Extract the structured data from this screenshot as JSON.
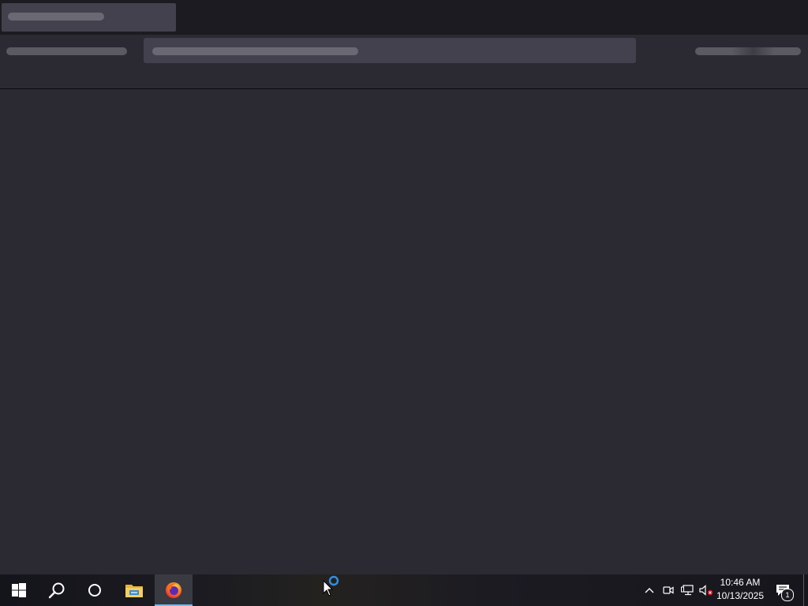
{
  "browser": {
    "tabs": [
      {
        "label": ""
      }
    ],
    "url": ""
  },
  "taskbar": {
    "start_icon": "windows-logo-icon",
    "search_icon": "search-icon",
    "task_view_icon": "cortana-circle-icon",
    "pinned": [
      {
        "name": "file-explorer",
        "icon": "folder-icon"
      },
      {
        "name": "firefox",
        "icon": "firefox-icon",
        "active": true
      }
    ],
    "tray_icons": [
      "chevron-up-icon",
      "meet-now-icon",
      "network-icon",
      "volume-muted-icon"
    ],
    "clock": {
      "time": "10:46 AM",
      "date": "10/13/2025"
    },
    "notification_count": "1",
    "accent_color": "#76b9ed"
  }
}
